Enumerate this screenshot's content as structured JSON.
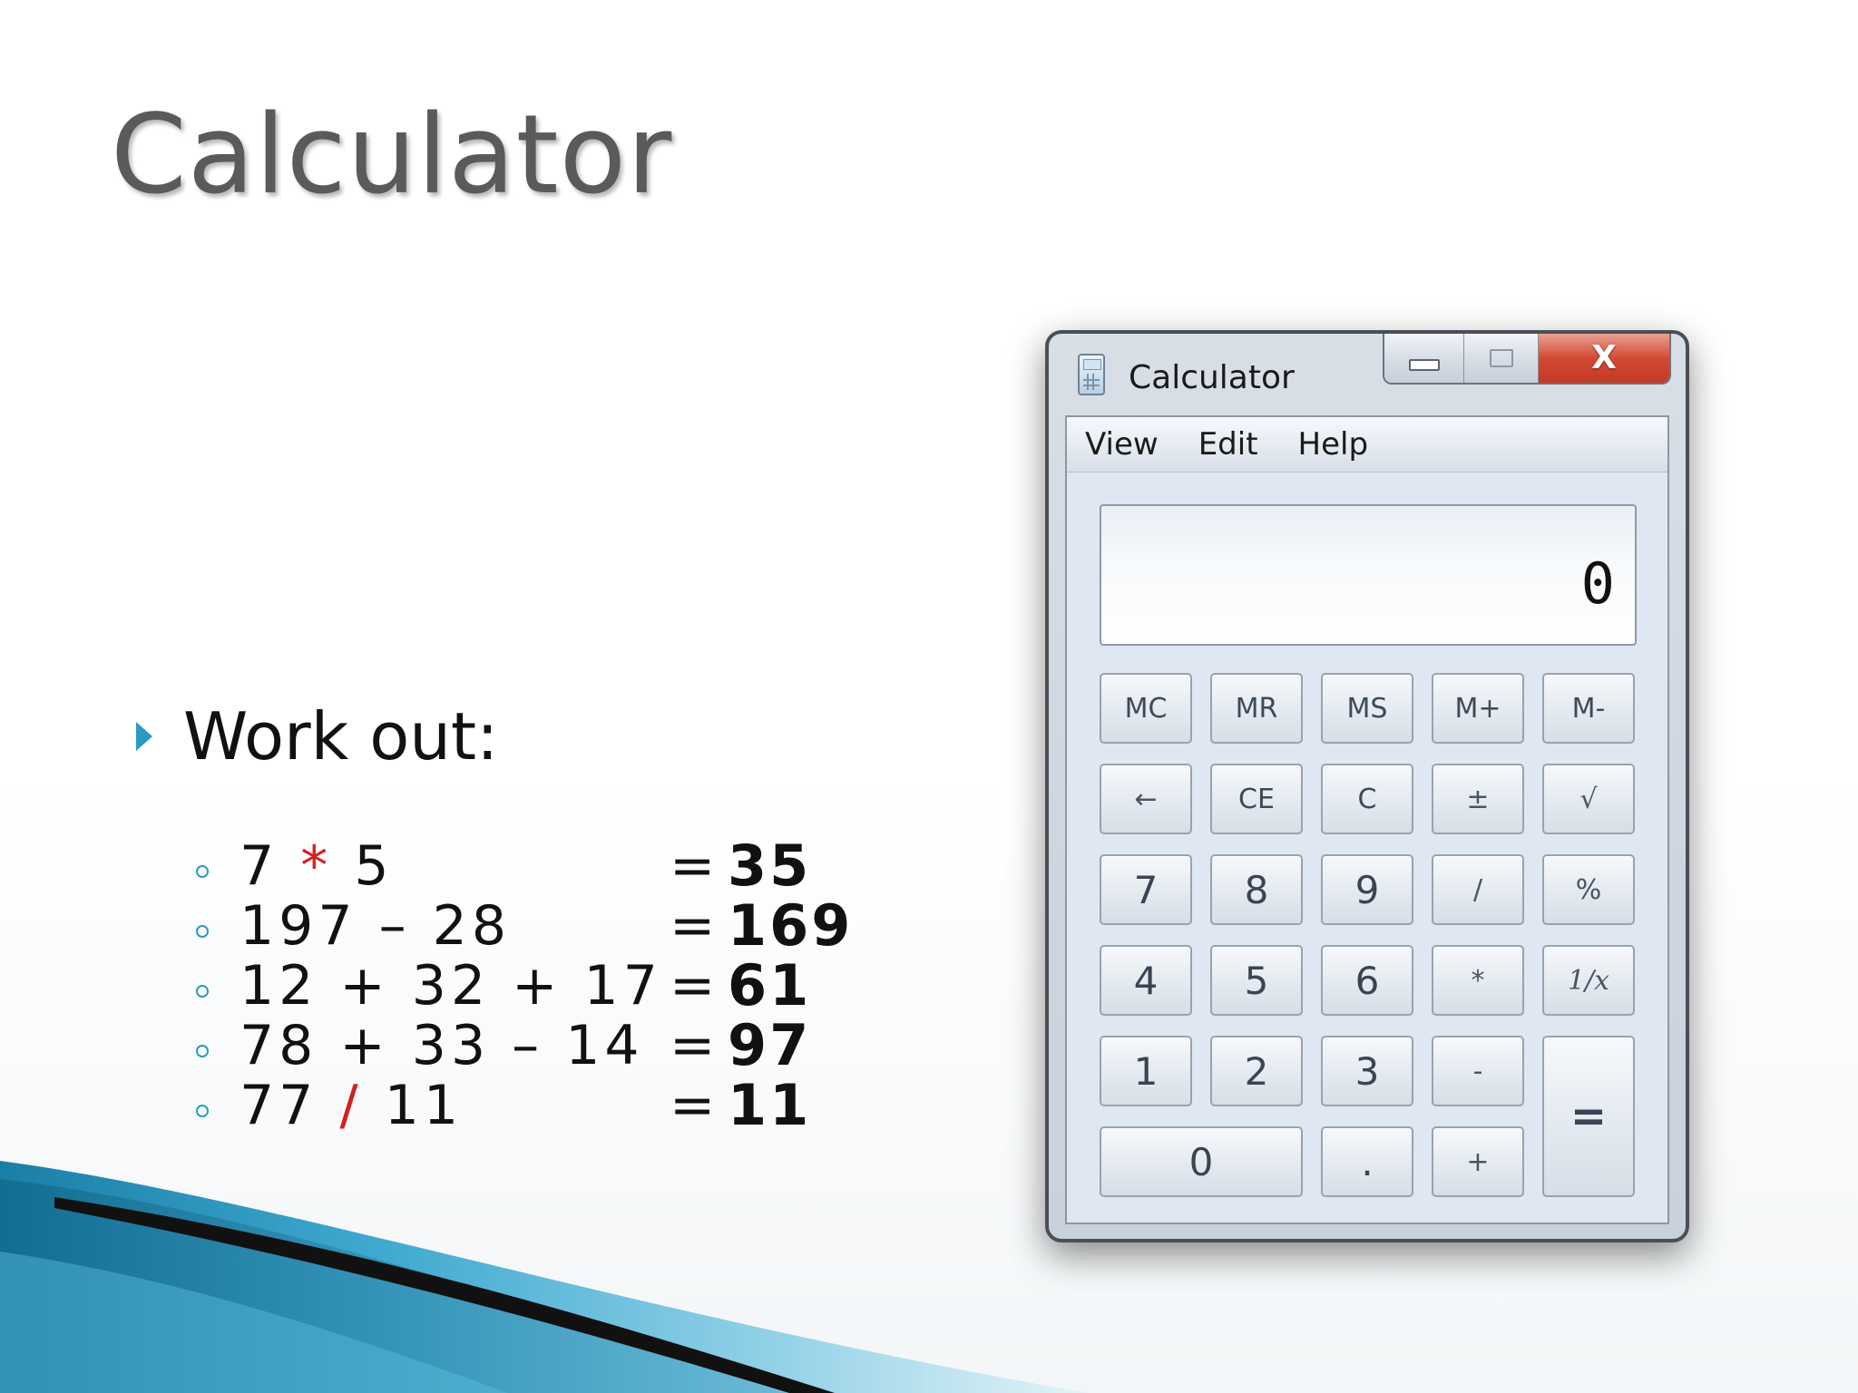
{
  "slide": {
    "title": "Calculator",
    "bullet": "Work out:",
    "equations": [
      {
        "left": "7 ",
        "op": "*",
        "right": " 5",
        "op_red": true,
        "equals": "=",
        "result": "35"
      },
      {
        "left": "197 – 28",
        "op": "",
        "right": "",
        "op_red": false,
        "equals": "=",
        "result": "169"
      },
      {
        "left": "12 + 32 + 17",
        "op": "",
        "right": "",
        "op_red": false,
        "equals": "=",
        "result": "61"
      },
      {
        "left": "78 + 33 – 14",
        "op": "",
        "right": "",
        "op_red": false,
        "equals": "=",
        "result": "97"
      },
      {
        "left": "77 ",
        "op": "/",
        "right": " 11",
        "op_red": true,
        "equals": "=",
        "result": "11"
      }
    ],
    "colors": {
      "accent": "#2b9bbf",
      "operator_red": "#d42020",
      "title_gray": "#5a5a5a"
    }
  },
  "calculator": {
    "title": "Calculator",
    "controls": {
      "minimize_icon": "minimize-icon",
      "maximize_icon": "maximize-icon",
      "close_label": "X"
    },
    "menu": [
      "View",
      "Edit",
      "Help"
    ],
    "display": "0",
    "keys": {
      "memory": [
        "MC",
        "MR",
        "MS",
        "M+",
        "M-"
      ],
      "row2": [
        "←",
        "CE",
        "C",
        "±",
        "√"
      ],
      "row3": [
        "7",
        "8",
        "9",
        "/",
        "%"
      ],
      "row4": [
        "4",
        "5",
        "6",
        "*",
        "1/x"
      ],
      "row5": [
        "1",
        "2",
        "3",
        "-"
      ],
      "row6": [
        "0",
        ".",
        "+"
      ],
      "equals": "="
    }
  }
}
